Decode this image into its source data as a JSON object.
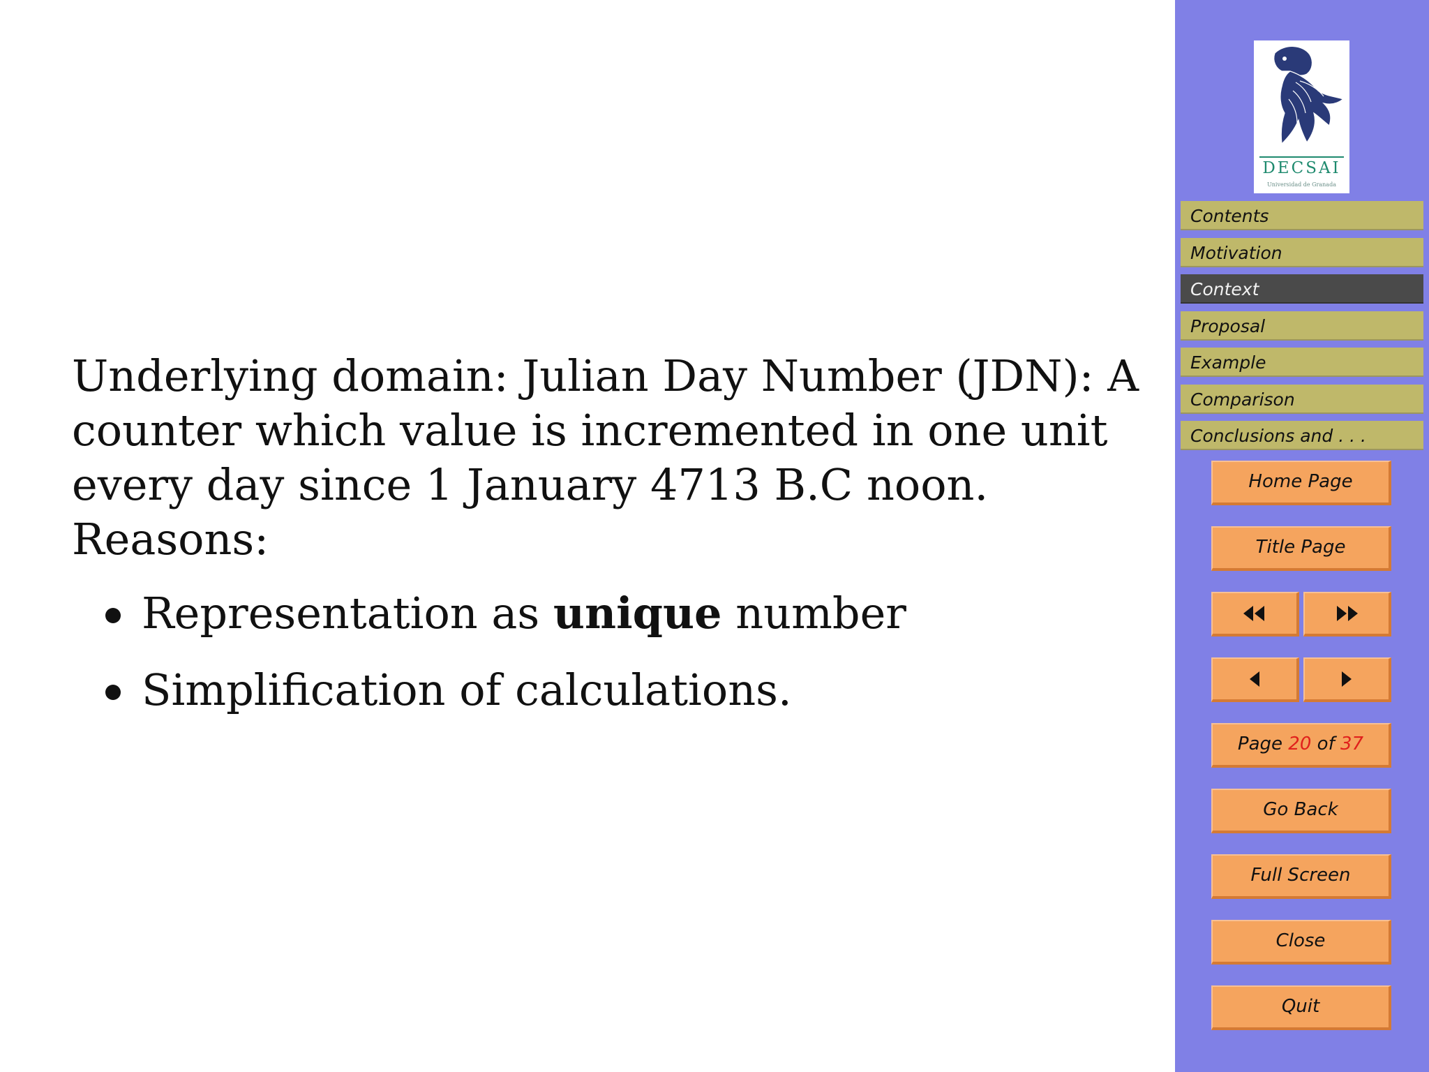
{
  "slide": {
    "paragraph": "Underlying domain:  Julian Day Number (JDN): A counter which value is incremented in one unit every day since 1 January 4713 B.C noon.",
    "reasons_label": "Reasons:",
    "bullets": [
      {
        "before": "Representation as ",
        "bold": "unique",
        "after": " number"
      },
      {
        "before": "Simplification of calculations.",
        "bold": "",
        "after": ""
      }
    ]
  },
  "sidebar": {
    "logo": {
      "text": "DECSAI",
      "subtitle": "Universidad de Granada"
    },
    "nav": [
      "Contents",
      "Motivation",
      "Context",
      "Proposal",
      "Example",
      "Comparison",
      "Conclusions and . . ."
    ],
    "active_nav_index": 2,
    "buttons": {
      "home": "Home Page",
      "title": "Title Page",
      "go_back": "Go Back",
      "full_screen": "Full Screen",
      "close": "Close",
      "quit": "Quit"
    },
    "pager": {
      "page_label": "Page",
      "current": "20",
      "of_label": "of",
      "total": "37"
    },
    "icons": {
      "first": "double-left-arrow-icon",
      "last": "double-right-arrow-icon",
      "prev": "left-arrow-icon",
      "next": "right-arrow-icon"
    },
    "colors": {
      "sidebar_bg": "#8080e6",
      "nav_bg": "#bfb86a",
      "nav_active_bg": "#4a4a4a",
      "button_bg": "#f5a45e",
      "page_number": "#e0201c"
    }
  }
}
